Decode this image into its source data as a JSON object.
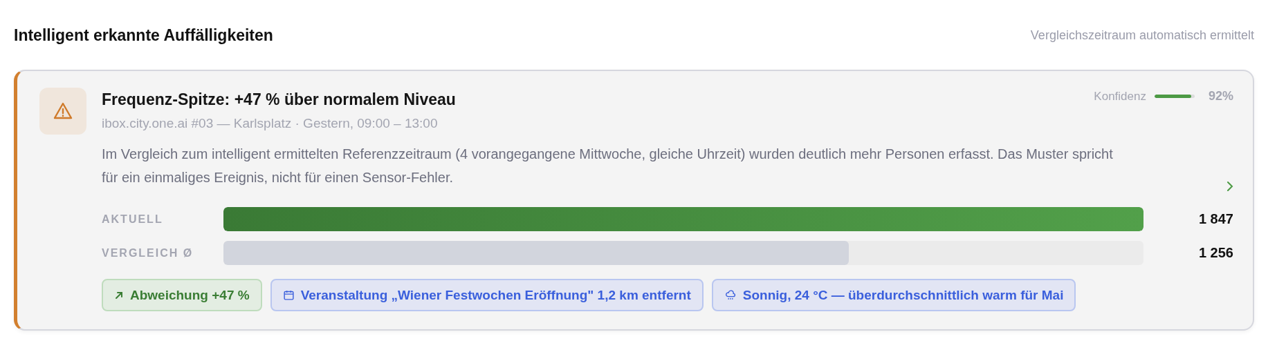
{
  "header": {
    "title": "Intelligent erkannte Auffälligkeiten",
    "note": "Vergleichszeitraum automatisch ermittelt"
  },
  "card": {
    "title": "Frequenz-Spitze: +47 % über normalem Niveau",
    "meta": "ibox.city.one.ai #03 — Karlsplatz · Gestern, 09:00 – 13:00",
    "confidence": {
      "label": "Konfidenz",
      "level": 0.92,
      "reading": "92%"
    },
    "description": "Im Vergleich zum intelligent ermittelten Referenzzeitraum (4 vorangegangene Mittwoche, gleiche Uhrzeit) wurden deutlich mehr Personen erfasst. Das Muster spricht für ein einmaliges Ereignis, nicht für einen Sensor-Fehler.",
    "bars": [
      {
        "kind": "current",
        "label": "AKTUELL",
        "level": 1.0,
        "value": "1 847"
      },
      {
        "kind": "reference",
        "label": "VERGLEICH Ø",
        "level": 0.68,
        "value": "1 256"
      }
    ],
    "tags": [
      {
        "kind": "trend",
        "text": "Abweichung +47 %"
      },
      {
        "kind": "event",
        "text": "Veranstaltung „Wiener Festwochen Eröffnung\" 1,2 km entfernt"
      },
      {
        "kind": "weather",
        "text": "Sonnig, 24 °C — überdurchschnittlich warm für Mai"
      }
    ]
  }
}
